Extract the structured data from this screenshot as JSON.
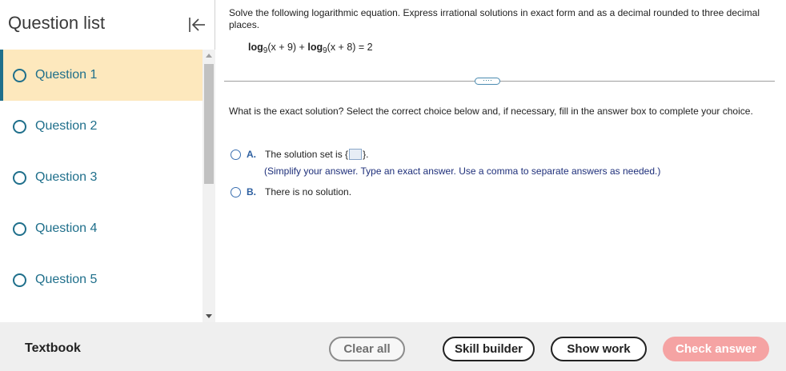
{
  "sidebar": {
    "title": "Question list",
    "questions": [
      {
        "label": "Question 1",
        "active": true
      },
      {
        "label": "Question 2",
        "active": false
      },
      {
        "label": "Question 3",
        "active": false
      },
      {
        "label": "Question 4",
        "active": false
      },
      {
        "label": "Question 5",
        "active": false
      }
    ]
  },
  "main": {
    "prompt": "Solve the following logarithmic equation. Express irrational solutions in exact form and as a decimal rounded to three decimal places.",
    "equation": {
      "log1": "log",
      "base1": "9",
      "arg1": "(x + 9) + ",
      "log2": "log",
      "base2": "9",
      "arg2": "(x + 8) = 2"
    },
    "more_label": "····",
    "question": "What is the exact solution? Select the correct choice below and, if necessary, fill in the answer box to complete your choice.",
    "choices": [
      {
        "letter": "A.",
        "text_before": "The solution set is {",
        "text_after": "}.",
        "hint": "(Simplify your answer. Type an exact answer. Use a comma to separate answers as needed.)"
      },
      {
        "letter": "B.",
        "text": "There is no solution."
      }
    ]
  },
  "bottom_bar": {
    "textbook": "Textbook",
    "clear_all": "Clear all",
    "skill_builder": "Skill builder",
    "show_work": "Show work",
    "check_answer": "Check answer"
  },
  "colors": {
    "accent": "#1f6f8b",
    "active_bg": "#fde8bd",
    "check_answer_bg": "#f5a3a3"
  }
}
